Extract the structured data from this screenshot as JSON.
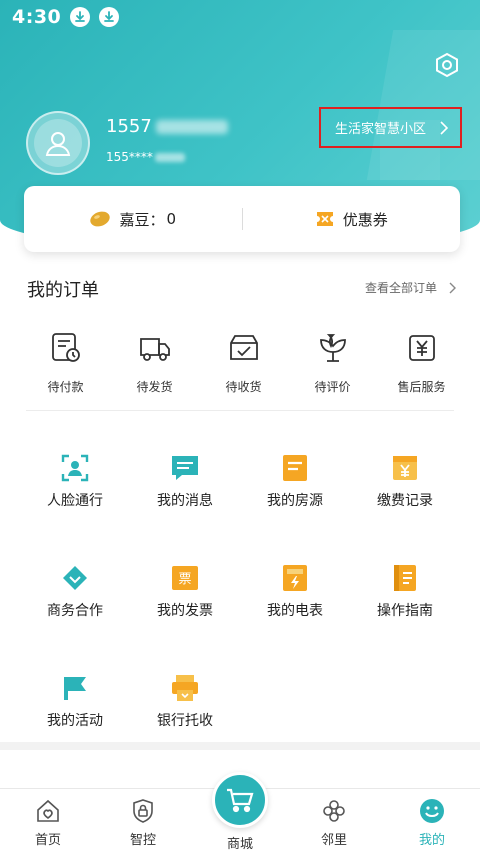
{
  "status_bar": {
    "time": "4:30"
  },
  "profile": {
    "name_prefix": "1557",
    "phone_prefix": "155****",
    "community_link": "生活家智慧小区"
  },
  "assets": {
    "beans_label": "嘉豆：",
    "beans_value": "0",
    "coupon_label": "优惠券"
  },
  "orders": {
    "title": "我的订单",
    "view_all": "查看全部订单",
    "items": [
      {
        "label": "待付款",
        "icon": "pending-payment-icon"
      },
      {
        "label": "待发货",
        "icon": "pending-shipment-icon"
      },
      {
        "label": "待收货",
        "icon": "pending-receipt-icon"
      },
      {
        "label": "待评价",
        "icon": "pending-review-icon"
      },
      {
        "label": "售后服务",
        "icon": "after-sales-icon"
      }
    ]
  },
  "services": [
    {
      "label": "人脸通行",
      "icon": "face-access-icon"
    },
    {
      "label": "我的消息",
      "icon": "message-icon"
    },
    {
      "label": "我的房源",
      "icon": "property-icon"
    },
    {
      "label": "缴费记录",
      "icon": "payment-record-icon"
    },
    {
      "label": "商务合作",
      "icon": "business-icon"
    },
    {
      "label": "我的发票",
      "icon": "invoice-icon"
    },
    {
      "label": "我的电表",
      "icon": "meter-icon"
    },
    {
      "label": "操作指南",
      "icon": "guide-icon"
    },
    {
      "label": "我的活动",
      "icon": "activity-icon"
    },
    {
      "label": "银行托收",
      "icon": "bank-icon"
    }
  ],
  "bottom_nav": {
    "home": "首页",
    "control": "智控",
    "mall": "商城",
    "neighbors": "邻里",
    "mine": "我的"
  },
  "colors": {
    "brand": "#2bb3b8",
    "accent_orange": "#f5a623",
    "highlight_border": "#e02020"
  }
}
